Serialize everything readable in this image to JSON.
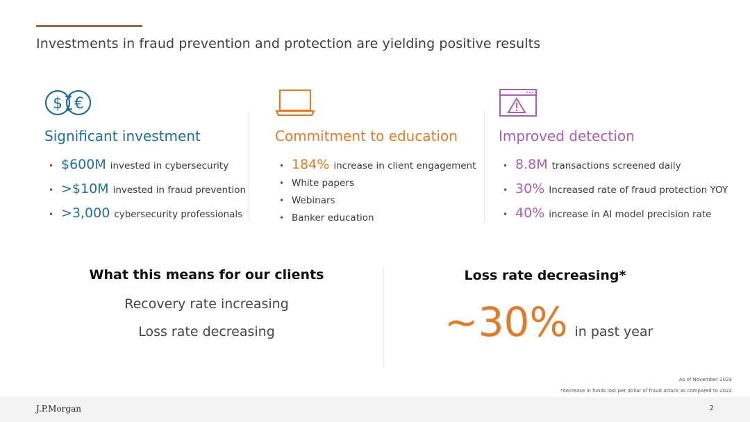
{
  "title": "Investments in fraud prevention and protection are yielding positive results",
  "columns": [
    {
      "icon": "currency-exchange-icon",
      "heading": "Significant investment",
      "color": "#1f6d9e",
      "items": [
        {
          "big": "$600M",
          "text": "invested in cybersecurity"
        },
        {
          "big": ">$10M",
          "text": "invested in fraud prevention"
        },
        {
          "big": ">3,000",
          "text": "cybersecurity professionals"
        }
      ]
    },
    {
      "icon": "laptop-icon",
      "heading": "Commitment to education",
      "color": "#e07b2a",
      "items": [
        {
          "big": "184%",
          "text": "increase in client engagement"
        },
        {
          "big": "",
          "text": "White papers"
        },
        {
          "big": "",
          "text": "Webinars"
        },
        {
          "big": "",
          "text": "Banker education"
        }
      ]
    },
    {
      "icon": "browser-warning-icon",
      "heading": "Improved detection",
      "color": "#ad5cb3",
      "items": [
        {
          "big": "8.8M",
          "text": "transactions screened daily"
        },
        {
          "big": "30%",
          "text": "Increased rate of fraud protection YOY"
        },
        {
          "big": "40%",
          "text": "increase in AI model precision rate"
        }
      ]
    }
  ],
  "clients": {
    "heading": "What this means for our clients",
    "lines": [
      "Recovery rate increasing",
      "Loss rate decreasing"
    ]
  },
  "loss": {
    "heading": "Loss rate decreasing*",
    "value": "~30%",
    "suffix": "in past year"
  },
  "notes": {
    "as_of": "As of November 2023",
    "footnote": "*decrease in funds lost per dollar of fraud attack as compared to 2022"
  },
  "footer": {
    "logo": "J.P.Morgan",
    "page": "2"
  }
}
